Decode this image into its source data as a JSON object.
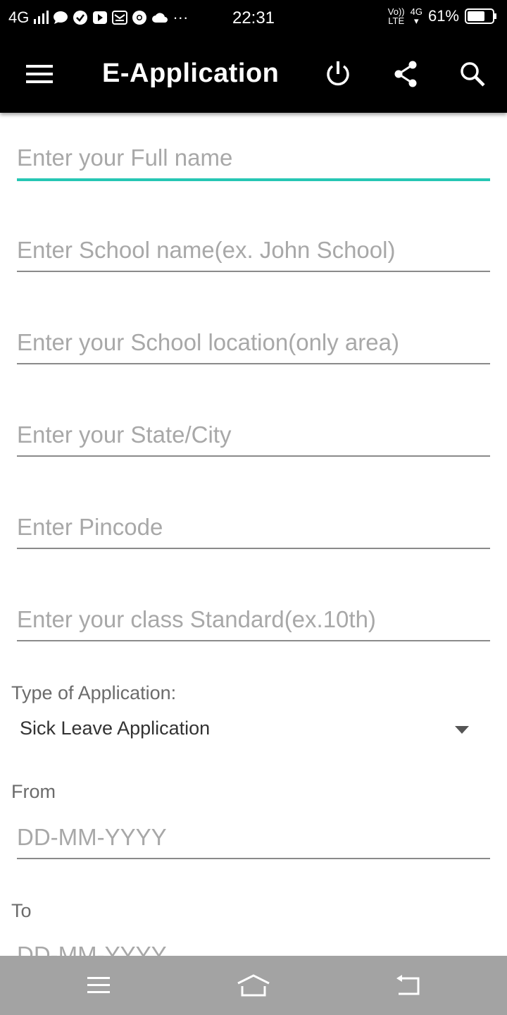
{
  "status_bar": {
    "network": "4G",
    "time": "22:31",
    "volte_top": "Vo))",
    "volte_bottom": "LTE",
    "data_type": "4G",
    "battery": "61%",
    "more": "···"
  },
  "app_bar": {
    "title": "E-Application",
    "icons": [
      "menu-icon",
      "power-icon",
      "share-icon",
      "search-icon"
    ]
  },
  "form": {
    "full_name": {
      "placeholder": "Enter your Full name",
      "value": ""
    },
    "school_name": {
      "placeholder": "Enter School name(ex. John School)",
      "value": ""
    },
    "school_location": {
      "placeholder": "Enter your School location(only area)",
      "value": ""
    },
    "state_city": {
      "placeholder": "Enter your State/City",
      "value": ""
    },
    "pincode": {
      "placeholder": "Enter Pincode",
      "value": ""
    },
    "class_standard": {
      "placeholder": "Enter your class Standard(ex.10th)",
      "value": ""
    },
    "application_type_label": "Type of Application:",
    "application_type_selected": "Sick Leave Application",
    "from_label": "From",
    "from_date": {
      "placeholder": "DD-MM-YYYY",
      "value": ""
    },
    "to_label": "To",
    "to_date": {
      "placeholder": "DD-MM-YYYY",
      "value": ""
    }
  },
  "colors": {
    "app_bar": "#000000",
    "accent": "#26c6b4",
    "nav_bar": "#a3a3a3"
  }
}
